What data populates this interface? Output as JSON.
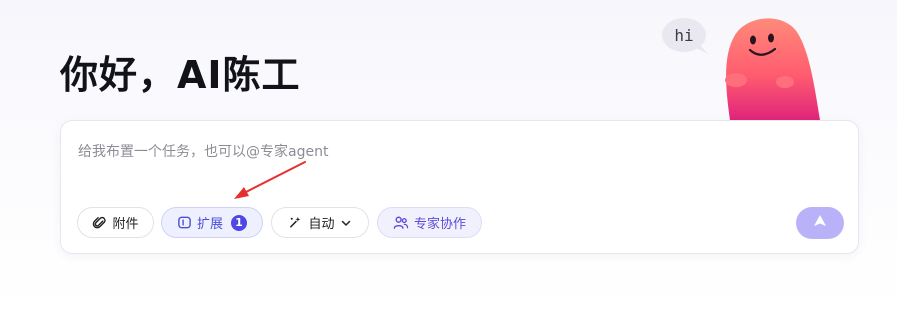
{
  "greeting": "你好，AI陈工",
  "mascot": {
    "speech": "hi"
  },
  "composer": {
    "placeholder": "给我布置一个任务，也可以@专家agent",
    "attach_label": "附件",
    "extend_label": "扩展",
    "extend_badge": "1",
    "auto_label": "自动",
    "expert_label": "专家协作"
  },
  "colors": {
    "accent": "#4f46e5",
    "send_button": "#b9b2f8",
    "annotation_arrow": "#e5302e"
  },
  "icons": [
    "paperclip-icon",
    "extension-icon",
    "auto-mode-icon",
    "chevron-down-icon",
    "people-icon",
    "send-icon"
  ]
}
